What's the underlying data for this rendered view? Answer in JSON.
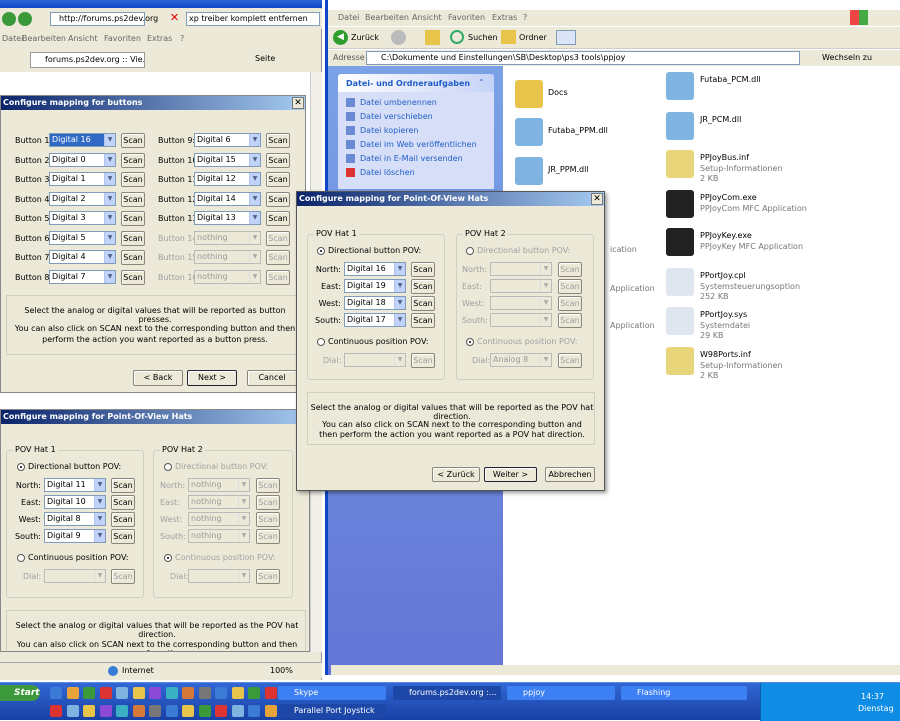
{
  "ie": {
    "address": "http://forums.ps2dev.org",
    "search": "xp treiber komplett entfernen",
    "menu": [
      "Datei",
      "Bearbeiten",
      "Ansicht",
      "Favoriten",
      "Extras",
      "?"
    ],
    "tab": "forums.ps2dev.org :: Vie...",
    "page_btn": "Seite",
    "status": "Internet",
    "zoom": "100%"
  },
  "explorer": {
    "menu": [
      "Datei",
      "Bearbeiten",
      "Ansicht",
      "Favoriten",
      "Extras",
      "?"
    ],
    "back": "Zurück",
    "search": "Suchen",
    "folders": "Ordner",
    "address_label": "Adresse",
    "address": "C:\\Dokumente und Einstellungen\\SB\\Desktop\\ps3 tools\\ppjoy",
    "go": "Wechseln zu",
    "task_title": "Datei- und Ordneraufgaben",
    "tasks": [
      "Datei umbenennen",
      "Datei verschieben",
      "Datei kopieren",
      "Datei im Web veröffentlichen",
      "Datei in E-Mail versenden",
      "Datei löschen"
    ],
    "files_left": [
      {
        "name": "Docs"
      },
      {
        "name": "Futaba_PPM.dll"
      },
      {
        "name": "JR_PPM.dll"
      }
    ],
    "files_right": [
      {
        "name": "Futaba_PCM.dll",
        "sub": "",
        "sub2": ""
      },
      {
        "name": "JR_PCM.dll",
        "sub": "",
        "sub2": ""
      },
      {
        "name": "PPJoyBus.inf",
        "sub": "Setup-Informationen",
        "sub2": "2 KB"
      },
      {
        "name": "PPJoyCom.exe",
        "sub": "PPJoyCom MFC Application",
        "sub2": ""
      },
      {
        "name": "PPJoyKey.exe",
        "sub": "PPJoyKey MFC Application",
        "sub2": ""
      },
      {
        "name": "PPortJoy.cpl",
        "sub": "Systemsteuerungsoption",
        "sub2": "252 KB"
      },
      {
        "name": "PPortJoy.sys",
        "sub": "Systemdatei",
        "sub2": "29 KB"
      },
      {
        "name": "W98Ports.inf",
        "sub": "Setup-Informationen",
        "sub2": "2 KB"
      }
    ],
    "partial": [
      "ication",
      "Application",
      "Application"
    ]
  },
  "buttons_dlg": {
    "title": "Configure mapping for buttons",
    "left": [
      {
        "label": "Button 1:",
        "value": "Digital 16"
      },
      {
        "label": "Button 2:",
        "value": "Digital 0"
      },
      {
        "label": "Button 3:",
        "value": "Digital 1"
      },
      {
        "label": "Button 4:",
        "value": "Digital 2"
      },
      {
        "label": "Button 5:",
        "value": "Digital 3"
      },
      {
        "label": "Button 6:",
        "value": "Digital 5"
      },
      {
        "label": "Button 7:",
        "value": "Digital 4"
      },
      {
        "label": "Button 8:",
        "value": "Digital 7"
      }
    ],
    "right": [
      {
        "label": "Button 9:",
        "value": "Digital 6"
      },
      {
        "label": "Button 10:",
        "value": "Digital 15"
      },
      {
        "label": "Button 11:",
        "value": "Digital 12"
      },
      {
        "label": "Button 12:",
        "value": "Digital 14"
      },
      {
        "label": "Button 13:",
        "value": "Digital 13"
      },
      {
        "label": "Button 14:",
        "value": "nothing"
      },
      {
        "label": "Button 15:",
        "value": "nothing"
      },
      {
        "label": "Button 16:",
        "value": "nothing"
      }
    ],
    "scan": "Scan",
    "info1": "Select the analog or digital values that will be reported as button presses.",
    "info2": "You can also click on SCAN next to the corresponding button and then perform the action you want reported as a button press.",
    "back": "< Back",
    "next": "Next >",
    "cancel": "Cancel"
  },
  "pov_back": {
    "title": "Configure mapping for Point-Of-View Hats",
    "hat1": "POV Hat 1",
    "hat2": "POV Hat 2",
    "dir": "Directional button POV:",
    "cont": "Continuous position POV:",
    "rows": [
      {
        "label": "North:",
        "value": "Digital 11"
      },
      {
        "label": "East:",
        "value": "Digital 10"
      },
      {
        "label": "West:",
        "value": "Digital 8"
      },
      {
        "label": "South:",
        "value": "Digital 9"
      }
    ],
    "dial": "Dial:",
    "nothing": "nothing",
    "scan": "Scan",
    "info1": "Select the analog or digital values that will be reported as the POV hat direction.",
    "info2": "You can also click on SCAN next to the corresponding button and then perform the"
  },
  "pov_front": {
    "title": "Configure mapping for Point-Of-View Hats",
    "hat1": "POV Hat 1",
    "hat2": "POV Hat 2",
    "dir": "Directional button POV:",
    "cont": "Continuous position POV:",
    "rows": [
      {
        "label": "North:",
        "value": "Digital 16"
      },
      {
        "label": "East:",
        "value": "Digital 19"
      },
      {
        "label": "West:",
        "value": "Digital 18"
      },
      {
        "label": "South:",
        "value": "Digital 17"
      }
    ],
    "dial": "Dial:",
    "analog": "Analog 8",
    "scan": "Scan",
    "info1": "Select the analog or digital values that will be reported as the POV hat direction.",
    "info2": "You can also click on SCAN next to the corresponding button and then perform the action you want reported as a POV hat direction.",
    "back": "< Zurück",
    "next": "Weiter >",
    "cancel": "Abbrechen"
  },
  "taskbar": {
    "start": "Start",
    "items": [
      "Skype",
      "forums.ps2dev.org :...",
      "ppjoy",
      "Flashing",
      "Parallel Port Joystick"
    ],
    "time": "14:37",
    "day": "Dienstag"
  }
}
